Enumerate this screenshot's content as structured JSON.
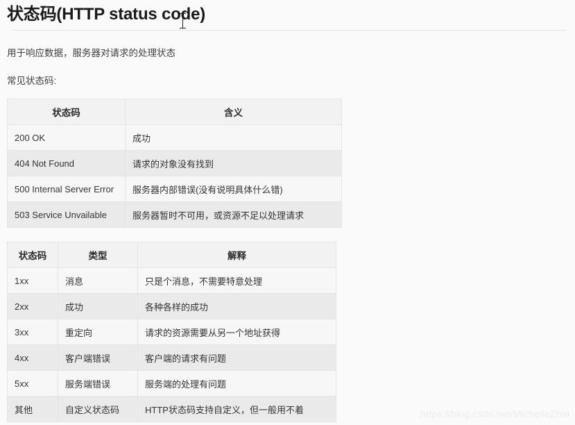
{
  "header": {
    "title": "状态码(HTTP status code)"
  },
  "intro": {
    "line1": "用于响应数据，服务器对请求的处理状态",
    "line2": "常见状态码:"
  },
  "status_table": {
    "columns": [
      "状态码",
      "含义"
    ],
    "rows": [
      [
        "200 OK",
        "成功"
      ],
      [
        "404 Not Found",
        "请求的对象没有找到"
      ],
      [
        "500 Internal Server Error",
        "服务器内部错误(没有说明具体什么错)"
      ],
      [
        "503 Service Unvailable",
        "服务器暂时不可用，或资源不足以处理请求"
      ]
    ]
  },
  "class_table": {
    "columns": [
      "状态码",
      "类型",
      "解释"
    ],
    "rows": [
      [
        "1xx",
        "消息",
        "只是个消息，不需要特意处理"
      ],
      [
        "2xx",
        "成功",
        "各种各样的成功"
      ],
      [
        "3xx",
        "重定向",
        "请求的资源需要从另一个地址获得"
      ],
      [
        "4xx",
        "客户端错误",
        "客户端的请求有问题"
      ],
      [
        "5xx",
        "服务端错误",
        "服务端的处理有问题"
      ],
      [
        "其他",
        "自定义状态码",
        "HTTP状态码支持自定义，但一般用不着"
      ]
    ]
  },
  "watermark": {
    "text": "https://blog.csdn.net/MichelleZhai"
  },
  "colors": {
    "page_background": "#fafafa",
    "table_header_background": "#f2f2f2",
    "row_odd_background": "#f7f7f7",
    "row_even_background": "#eaeaea",
    "border": "#e4e4e4",
    "text": "#333333",
    "watermark": "#ececec"
  }
}
